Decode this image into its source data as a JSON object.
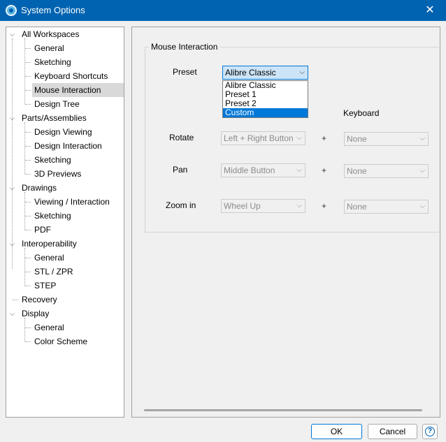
{
  "window": {
    "title": "System Options",
    "close_icon": "close-icon",
    "app_icon": "gear-icon"
  },
  "tree": {
    "groups": [
      {
        "label": "All Workspaces",
        "children": [
          "General",
          "Sketching",
          "Keyboard Shortcuts",
          "Mouse Interaction",
          "Design Tree"
        ]
      },
      {
        "label": "Parts/Assemblies",
        "children": [
          "Design Viewing",
          "Design Interaction",
          "Sketching",
          "3D Previews"
        ]
      },
      {
        "label": "Drawings",
        "children": [
          "Viewing / Interaction",
          "Sketching",
          "PDF"
        ]
      },
      {
        "label": "Interoperability",
        "children": [
          "General",
          "STL / ZPR",
          "STEP"
        ]
      },
      {
        "label": "Recovery",
        "children": []
      },
      {
        "label": "Display",
        "children": [
          "General",
          "Color Scheme"
        ]
      }
    ],
    "selected": "Mouse Interaction"
  },
  "panel": {
    "group_title": "Mouse Interaction",
    "preset_label": "Preset",
    "preset_value": "Alibre Classic",
    "preset_options": [
      "Alibre Classic",
      "Preset 1",
      "Preset 2",
      "Custom"
    ],
    "preset_highlighted": "Custom",
    "keyboard_header": "Keyboard",
    "plus": "+",
    "rows": [
      {
        "label": "Rotate",
        "mouse": "Left + Right Button",
        "keyboard": "None"
      },
      {
        "label": "Pan",
        "mouse": "Middle Button",
        "keyboard": "None"
      },
      {
        "label": "Zoom in",
        "mouse": "Wheel Up",
        "keyboard": "None"
      }
    ]
  },
  "buttons": {
    "ok": "OK",
    "cancel": "Cancel",
    "help": "?"
  }
}
